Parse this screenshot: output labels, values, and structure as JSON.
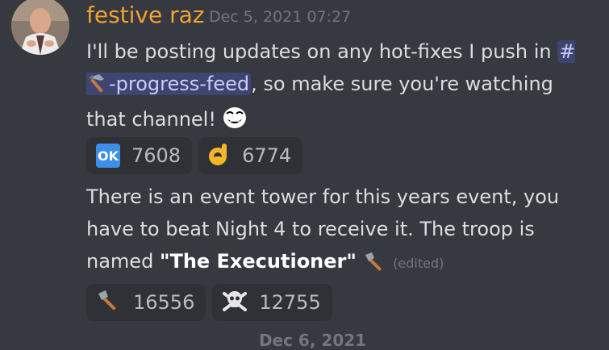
{
  "message": {
    "author": "festive raz",
    "timestamp": "Dec 5, 2021 07:27",
    "text1_part1": "I'll be posting updates on any hot-fixes I push in ",
    "channel_mention_hash": "#",
    "channel_mention_name": "-progress-feed",
    "text1_part2": ", so make sure you're watching that channel! ",
    "reactions1": [
      {
        "icon": "ok-button-icon",
        "label": "OK",
        "count": "7608"
      },
      {
        "icon": "ok-hand-icon",
        "count": "6774"
      }
    ],
    "text2_part1": "There is an event tower for this years event, you have to beat Night 4 to receive it. The troop is named ",
    "text2_bold": "\"The Executioner\"",
    "edited_label": "(edited)",
    "reactions2": [
      {
        "icon": "axe-icon",
        "count": "16556"
      },
      {
        "icon": "skull-crossbones-icon",
        "count": "12755"
      }
    ]
  },
  "next_date_divider": "Dec 6, 2021",
  "colors": {
    "background": "#36393f",
    "author": "#f0a232",
    "mention_bg": "#3f4470",
    "reaction_bg": "#2f3136"
  }
}
